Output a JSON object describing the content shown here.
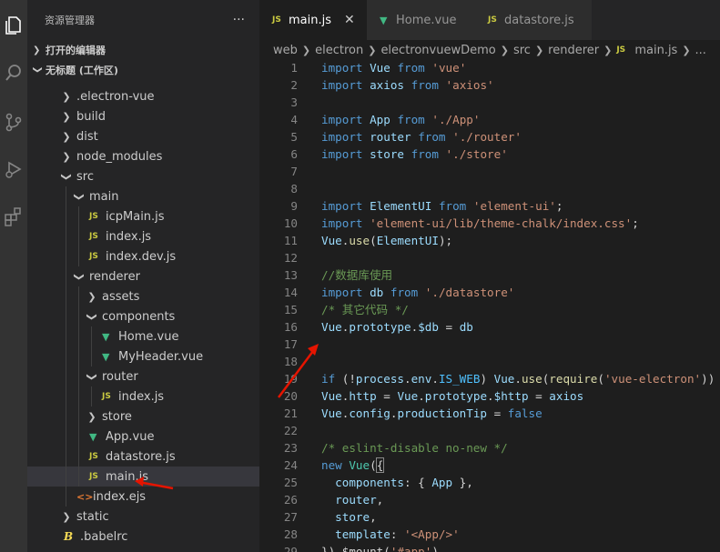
{
  "activity_bar": {
    "icons": [
      "explorer-icon",
      "search-icon",
      "source-control-icon",
      "run-debug-icon",
      "extensions-icon"
    ]
  },
  "sidebar": {
    "title": "资源管理器",
    "more": "···",
    "open_editors_label": "打开的编辑器",
    "workspace_label": "无标题 (工作区)",
    "tree": [
      {
        "label": ".electron-vue",
        "kind": "folder",
        "expanded": false,
        "icon": "chevron-right"
      },
      {
        "label": "build",
        "kind": "folder",
        "expanded": false,
        "icon": "chevron-right"
      },
      {
        "label": "dist",
        "kind": "folder",
        "expanded": false,
        "icon": "chevron-right"
      },
      {
        "label": "node_modules",
        "kind": "folder",
        "expanded": false,
        "icon": "chevron-right"
      },
      {
        "label": "src",
        "kind": "folder",
        "expanded": true,
        "icon": "chevron-down"
      },
      {
        "label": "main",
        "kind": "folder",
        "expanded": true,
        "icon": "chevron-down"
      },
      {
        "label": "icpMain.js",
        "kind": "js",
        "icon_text": "JS"
      },
      {
        "label": "index.js",
        "kind": "js",
        "icon_text": "JS"
      },
      {
        "label": "index.dev.js",
        "kind": "js",
        "icon_text": "JS"
      },
      {
        "label": "renderer",
        "kind": "folder",
        "expanded": true,
        "icon": "chevron-down"
      },
      {
        "label": "assets",
        "kind": "folder",
        "expanded": false,
        "icon": "chevron-right"
      },
      {
        "label": "components",
        "kind": "folder",
        "expanded": true,
        "icon": "chevron-down"
      },
      {
        "label": "Home.vue",
        "kind": "vue",
        "icon_text": "▼"
      },
      {
        "label": "MyHeader.vue",
        "kind": "vue",
        "icon_text": "▼"
      },
      {
        "label": "router",
        "kind": "folder",
        "expanded": true,
        "icon": "chevron-down"
      },
      {
        "label": "index.js",
        "kind": "js",
        "icon_text": "JS"
      },
      {
        "label": "store",
        "kind": "folder",
        "expanded": false,
        "icon": "chevron-right"
      },
      {
        "label": "App.vue",
        "kind": "vue",
        "icon_text": "▼"
      },
      {
        "label": "datastore.js",
        "kind": "js",
        "icon_text": "JS"
      },
      {
        "label": "main.js",
        "kind": "js",
        "icon_text": "JS",
        "selected": true
      },
      {
        "label": "index.ejs",
        "kind": "html",
        "icon_text": "<>"
      },
      {
        "label": "static",
        "kind": "folder",
        "expanded": false,
        "icon": "chevron-right"
      },
      {
        "label": ".babelrc",
        "kind": "babel",
        "icon_text": "B"
      }
    ]
  },
  "tabs": [
    {
      "label": "main.js",
      "icon_text": "JS",
      "kind": "js",
      "active": true,
      "close": "✕"
    },
    {
      "label": "Home.vue",
      "icon_text": "▼",
      "kind": "vue",
      "active": false
    },
    {
      "label": "datastore.js",
      "icon_text": "JS",
      "kind": "js",
      "active": false
    }
  ],
  "breadcrumb": {
    "parts": [
      "web",
      "electron",
      "electronvuewDemo",
      "src",
      "renderer"
    ],
    "file_icon": "JS",
    "file": "main.js",
    "tail": "..."
  },
  "code_lines": [
    {
      "n": "1",
      "t": [
        [
          "kw",
          "import"
        ],
        [
          "pl",
          " "
        ],
        [
          "id",
          "Vue"
        ],
        [
          "pl",
          " "
        ],
        [
          "kw",
          "from"
        ],
        [
          "pl",
          " "
        ],
        [
          "str",
          "'vue'"
        ]
      ]
    },
    {
      "n": "2",
      "t": [
        [
          "kw",
          "import"
        ],
        [
          "pl",
          " "
        ],
        [
          "id",
          "axios"
        ],
        [
          "pl",
          " "
        ],
        [
          "kw",
          "from"
        ],
        [
          "pl",
          " "
        ],
        [
          "str",
          "'axios'"
        ]
      ]
    },
    {
      "n": "3",
      "t": []
    },
    {
      "n": "4",
      "t": [
        [
          "kw",
          "import"
        ],
        [
          "pl",
          " "
        ],
        [
          "id",
          "App"
        ],
        [
          "pl",
          " "
        ],
        [
          "kw",
          "from"
        ],
        [
          "pl",
          " "
        ],
        [
          "str",
          "'./App'"
        ]
      ]
    },
    {
      "n": "5",
      "t": [
        [
          "kw",
          "import"
        ],
        [
          "pl",
          " "
        ],
        [
          "id",
          "router"
        ],
        [
          "pl",
          " "
        ],
        [
          "kw",
          "from"
        ],
        [
          "pl",
          " "
        ],
        [
          "str",
          "'./router'"
        ]
      ]
    },
    {
      "n": "6",
      "t": [
        [
          "kw",
          "import"
        ],
        [
          "pl",
          " "
        ],
        [
          "id",
          "store"
        ],
        [
          "pl",
          " "
        ],
        [
          "kw",
          "from"
        ],
        [
          "pl",
          " "
        ],
        [
          "str",
          "'./store'"
        ]
      ]
    },
    {
      "n": "7",
      "t": []
    },
    {
      "n": "8",
      "t": []
    },
    {
      "n": "9",
      "t": [
        [
          "kw",
          "import"
        ],
        [
          "pl",
          " "
        ],
        [
          "id",
          "ElementUI"
        ],
        [
          "pl",
          " "
        ],
        [
          "kw",
          "from"
        ],
        [
          "pl",
          " "
        ],
        [
          "str",
          "'element-ui'"
        ],
        [
          "pl",
          ";"
        ]
      ]
    },
    {
      "n": "10",
      "t": [
        [
          "kw",
          "import"
        ],
        [
          "pl",
          " "
        ],
        [
          "str",
          "'element-ui/lib/theme-chalk/index.css'"
        ],
        [
          "pl",
          ";"
        ]
      ]
    },
    {
      "n": "11",
      "t": [
        [
          "id",
          "Vue"
        ],
        [
          "pl",
          "."
        ],
        [
          "fn",
          "use"
        ],
        [
          "pl",
          "("
        ],
        [
          "id",
          "ElementUI"
        ],
        [
          "pl",
          ");"
        ]
      ]
    },
    {
      "n": "12",
      "t": []
    },
    {
      "n": "13",
      "t": [
        [
          "cm",
          "//数据库使用"
        ]
      ]
    },
    {
      "n": "14",
      "t": [
        [
          "kw",
          "import"
        ],
        [
          "pl",
          " "
        ],
        [
          "id",
          "db"
        ],
        [
          "pl",
          " "
        ],
        [
          "kw",
          "from"
        ],
        [
          "pl",
          " "
        ],
        [
          "str",
          "'./datastore'"
        ]
      ]
    },
    {
      "n": "15",
      "t": [
        [
          "cm",
          "/* 其它代码 */"
        ]
      ]
    },
    {
      "n": "16",
      "t": [
        [
          "id",
          "Vue"
        ],
        [
          "pl",
          "."
        ],
        [
          "id",
          "prototype"
        ],
        [
          "pl",
          "."
        ],
        [
          "id",
          "$db"
        ],
        [
          "pl",
          " = "
        ],
        [
          "id",
          "db"
        ]
      ]
    },
    {
      "n": "17",
      "t": []
    },
    {
      "n": "18",
      "t": []
    },
    {
      "n": "19",
      "t": [
        [
          "kw",
          "if"
        ],
        [
          "pl",
          " (!"
        ],
        [
          "id",
          "process"
        ],
        [
          "pl",
          "."
        ],
        [
          "id",
          "env"
        ],
        [
          "pl",
          "."
        ],
        [
          "cyan",
          "IS_WEB"
        ],
        [
          "pl",
          ") "
        ],
        [
          "id",
          "Vue"
        ],
        [
          "pl",
          "."
        ],
        [
          "fn",
          "use"
        ],
        [
          "pl",
          "("
        ],
        [
          "fn",
          "require"
        ],
        [
          "pl",
          "("
        ],
        [
          "str",
          "'vue-electron'"
        ],
        [
          "pl",
          "))"
        ]
      ]
    },
    {
      "n": "20",
      "t": [
        [
          "id",
          "Vue"
        ],
        [
          "pl",
          "."
        ],
        [
          "id",
          "http"
        ],
        [
          "pl",
          " = "
        ],
        [
          "id",
          "Vue"
        ],
        [
          "pl",
          "."
        ],
        [
          "id",
          "prototype"
        ],
        [
          "pl",
          "."
        ],
        [
          "id",
          "$http"
        ],
        [
          "pl",
          " = "
        ],
        [
          "id",
          "axios"
        ]
      ]
    },
    {
      "n": "21",
      "t": [
        [
          "id",
          "Vue"
        ],
        [
          "pl",
          "."
        ],
        [
          "id",
          "config"
        ],
        [
          "pl",
          "."
        ],
        [
          "id",
          "productionTip"
        ],
        [
          "pl",
          " = "
        ],
        [
          "kw",
          "false"
        ]
      ]
    },
    {
      "n": "22",
      "t": []
    },
    {
      "n": "23",
      "t": [
        [
          "cm",
          "/* eslint-disable no-new */"
        ]
      ]
    },
    {
      "n": "24",
      "t": [
        [
          "kw",
          "new"
        ],
        [
          "pl",
          " "
        ],
        [
          "ty",
          "Vue"
        ],
        [
          "pl",
          "("
        ],
        [
          "hl",
          "{"
        ]
      ]
    },
    {
      "n": "25",
      "t": [
        [
          "pl",
          "  "
        ],
        [
          "id",
          "components"
        ],
        [
          "pl",
          ": { "
        ],
        [
          "id",
          "App"
        ],
        [
          "pl",
          " },"
        ]
      ]
    },
    {
      "n": "26",
      "t": [
        [
          "pl",
          "  "
        ],
        [
          "id",
          "router"
        ],
        [
          "pl",
          ","
        ]
      ]
    },
    {
      "n": "27",
      "t": [
        [
          "pl",
          "  "
        ],
        [
          "id",
          "store"
        ],
        [
          "pl",
          ","
        ]
      ]
    },
    {
      "n": "28",
      "t": [
        [
          "pl",
          "  "
        ],
        [
          "id",
          "template"
        ],
        [
          "pl",
          ": "
        ],
        [
          "str",
          "'<App/>'"
        ]
      ]
    },
    {
      "n": "29",
      "t": [
        [
          "pl",
          "}).$mount("
        ],
        [
          "str",
          "'#app'"
        ],
        [
          "pl",
          ")"
        ]
      ]
    }
  ],
  "colors": {
    "keyword": "#569cd6",
    "identifier": "#9cdcfe",
    "string": "#ce9178",
    "comment": "#6a9955",
    "annotation_arrow": "#e51400"
  }
}
